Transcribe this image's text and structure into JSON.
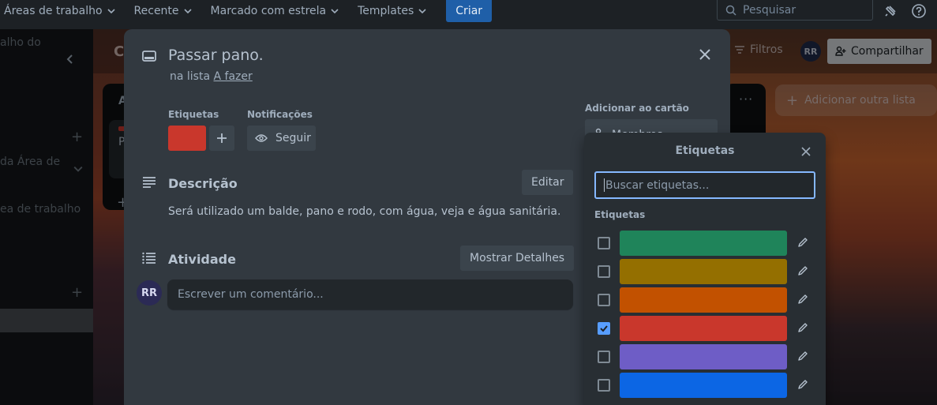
{
  "topbar": {
    "nav": [
      {
        "label": "Áreas de trabalho"
      },
      {
        "label": "Recente"
      },
      {
        "label": "Marcado com estrela"
      },
      {
        "label": "Templates"
      }
    ],
    "create_label": "Criar",
    "search_placeholder": "Pesquisar"
  },
  "sidebar": {
    "frag1": "alho do",
    "frag2": "da Área de",
    "frag3": "ea de trabalho"
  },
  "board": {
    "title_fragment": "C",
    "list_fragment_1": "A",
    "list_fragment_2": "P",
    "filters_label": "Filtros",
    "avatar_initials": "RR",
    "share_label": "Compartilhar",
    "add_list_label": "Adicionar outra lista"
  },
  "card": {
    "title": "Passar pano.",
    "in_list_prefix": "na lista",
    "list_name": "A fazer",
    "labels_heading": "Etiquetas",
    "notifications_heading": "Notificações",
    "follow_label": "Seguir",
    "description_heading": "Descrição",
    "edit_label": "Editar",
    "description_text": "Será utilizado um balde, pano e rodo, com água, veja e água sanitária.",
    "activity_heading": "Atividade",
    "show_details_label": "Mostrar Detalhes",
    "avatar_initials": "RR",
    "comment_placeholder": "Escrever um comentário...",
    "add_to_card_heading": "Adicionar ao cartão",
    "members_label": "Membros",
    "applied_label_color": "#c9372c"
  },
  "labels_popover": {
    "title": "Etiquetas",
    "search_placeholder": "Buscar etiquetas...",
    "section_heading": "Etiquetas",
    "labels": [
      {
        "color": "#1f845a",
        "checked": false
      },
      {
        "color": "#946f00",
        "checked": false
      },
      {
        "color": "#c25100",
        "checked": false
      },
      {
        "color": "#c9372c",
        "checked": true
      },
      {
        "color": "#6e5dc6",
        "checked": false
      },
      {
        "color": "#0c66e4",
        "checked": false
      }
    ]
  }
}
